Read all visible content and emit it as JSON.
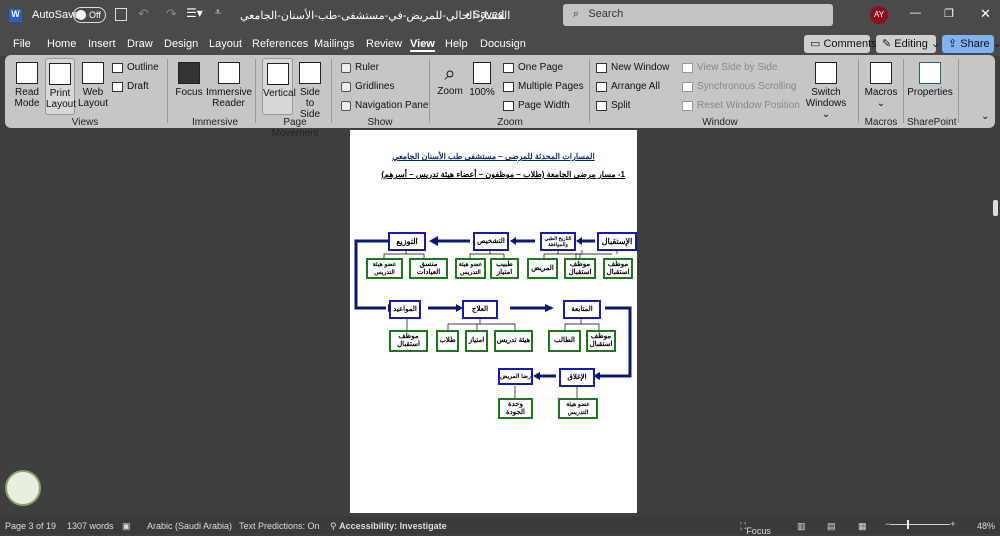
{
  "titlebar": {
    "autosave": "AutoSave",
    "toggle": "Off",
    "doc_title": "المسار-الحالي-للمريض-في-مستشفى-طب-الأسنان-الجامعي",
    "saved": "• Saved",
    "search_placeholder": "Search",
    "avatar": "AY"
  },
  "tabs": [
    "File",
    "Home",
    "Insert",
    "Draw",
    "Design",
    "Layout",
    "References",
    "Mailings",
    "Review",
    "View",
    "Help",
    "Docusign"
  ],
  "actions": {
    "comments": "Comments",
    "editing": "Editing",
    "share": "Share"
  },
  "ribbon": {
    "views": {
      "read_mode": "Read Mode",
      "print_layout": "Print Layout",
      "web_layout": "Web Layout",
      "outline": "Outline",
      "draft": "Draft",
      "label": "Views"
    },
    "immersive": {
      "focus": "Focus",
      "reader": "Immersive Reader",
      "label": "Immersive"
    },
    "page_movement": {
      "vertical": "Vertical",
      "side": "Side to Side",
      "label": "Page Movement"
    },
    "show": {
      "ruler": "Ruler",
      "gridlines": "Gridlines",
      "nav": "Navigation Pane",
      "label": "Show"
    },
    "zoom": {
      "zoom": "Zoom",
      "pct": "100%",
      "one": "One Page",
      "multi": "Multiple Pages",
      "width": "Page Width",
      "label": "Zoom"
    },
    "window": {
      "new": "New Window",
      "arrange": "Arrange All",
      "split": "Split",
      "side": "View Side by Side",
      "sync": "Synchronous Scrolling",
      "reset": "Reset Window Position",
      "switch": "Switch Windows",
      "label": "Window"
    },
    "macros": {
      "macros": "Macros",
      "label": "Macros"
    },
    "sharepoint": {
      "properties": "Properties",
      "label": "SharePoint"
    }
  },
  "document": {
    "title": "المسارات المحدثة للمرضى – مستشفى طب الأسنان الجامعي",
    "subtitle": "1- مسار مرضى الجامعة (طلاب – موظفون – أعضاء هيئة تدريس – أسرهم)",
    "nodes": [
      "الإستقبال",
      "التاريخ الطبي والموافقة",
      "التشخيص",
      "التوزيع",
      "موظف استقبال",
      "موظف استقبال",
      "المريض",
      "طبيب امتياز",
      "عضو هيئة التدريس",
      "منسق العيادات",
      "عضو هيئة التدريس",
      "المواعيد",
      "العلاج",
      "المتابعة",
      "موظف استقبال",
      "طلاب",
      "امتياز",
      "هيئة تدريس",
      "الطالب",
      "موظف استقبال",
      "الإغلاق",
      "رضا المريض",
      "عضو هيئة التدريس",
      "وحدة الجودة"
    ]
  },
  "status": {
    "page": "Page 3 of 19",
    "words": "1307 words",
    "language": "Arabic (Saudi Arabia)",
    "predictions": "Text Predictions: On",
    "accessibility": "Accessibility: Investigate",
    "focus": "Focus",
    "zoom": "48%",
    "zoom_fraction": 0.48
  }
}
